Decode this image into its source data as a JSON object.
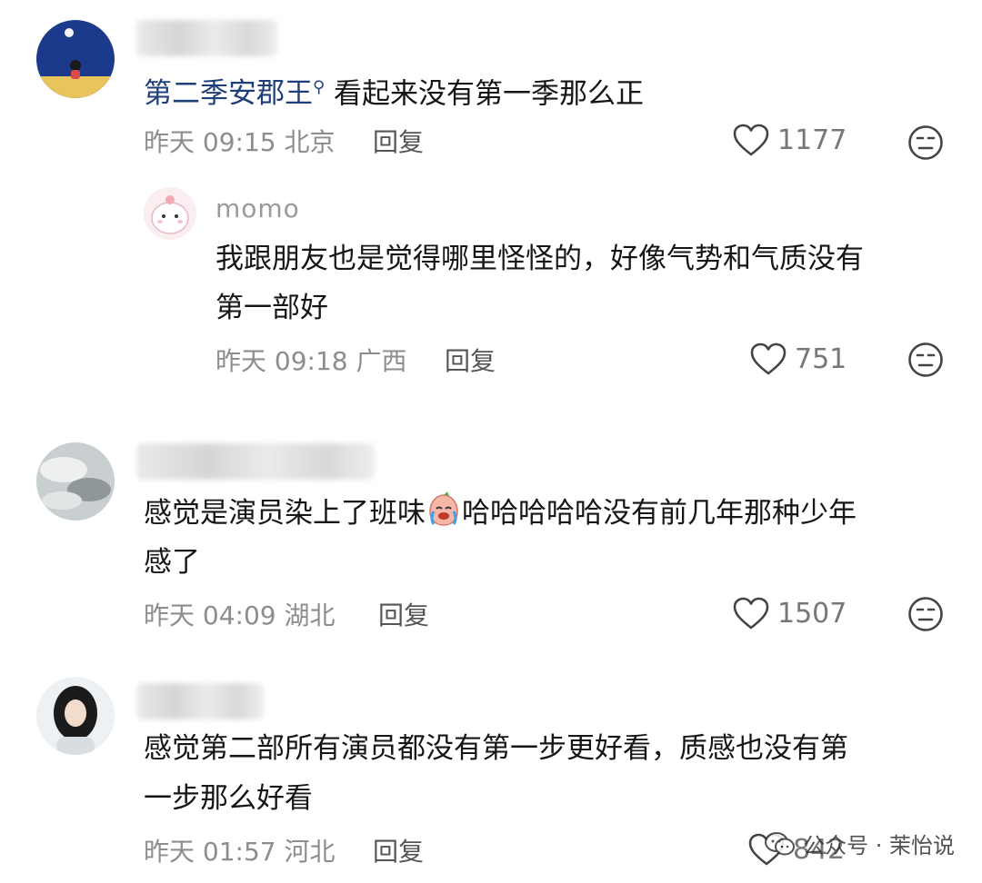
{
  "comments": [
    {
      "author": "",
      "mention": "第二季安郡王",
      "text_lines": [
        "看起来没有第一季那么正"
      ],
      "meta": "昨天 09:15 北京",
      "reply_label": "回复",
      "likes": "1177",
      "reply": {
        "author": "momo",
        "text_lines": [
          "我跟朋友也是觉得哪里怪怪的，好像气势和气质没有",
          "第一部好"
        ],
        "meta": "昨天 09:18 广西",
        "reply_label": "回复",
        "likes": "751"
      }
    },
    {
      "author": "",
      "text_before_emoji": "感觉是演员染上了班味",
      "text_after_emoji": "哈哈哈哈哈没有前几年那种少年",
      "text_line2": "感了",
      "meta": "昨天 04:09 湖北",
      "reply_label": "回复",
      "likes": "1507"
    },
    {
      "author": "",
      "text_lines": [
        "感觉第二部所有演员都没有第一步更好看，质感也没有第",
        "一步那么好看"
      ],
      "meta": "昨天 01:57 河北",
      "reply_label": "回复",
      "likes": "842"
    }
  ],
  "watermark": {
    "text": "公众号 · 茉怡说"
  },
  "icons": {
    "like": "heart-outline-icon",
    "dislike": "meh-face-icon",
    "search_mark": "search-icon",
    "watermark": "wechat-icon",
    "inline_emoji": "crying-laugh-emoji"
  }
}
